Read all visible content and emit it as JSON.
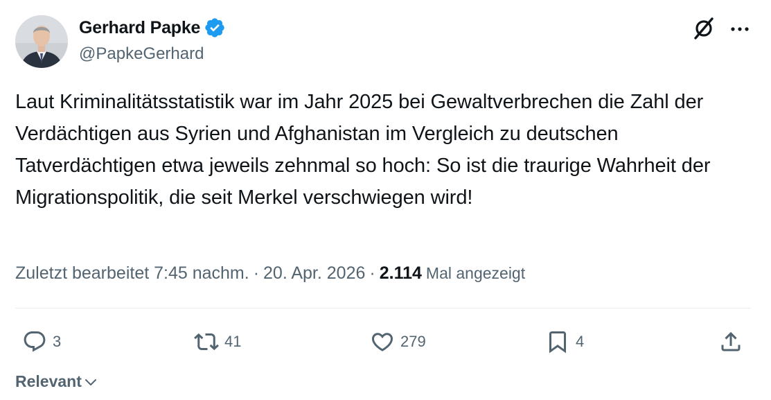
{
  "author": {
    "display_name": "Gerhard Papke",
    "handle": "@PapkeGerhard",
    "verified": true
  },
  "tweet": {
    "text": "Laut Kriminalitätsstatistik war im Jahr 2025 bei Gewaltverbrechen die Zahl der Verdächtigen aus Syrien und Afghanistan im Vergleich zu deutschen Tatverdächtigen etwa jeweils zehnmal so hoch: So ist die traurige Wahrheit der Migrationspolitik, die seit Merkel verschwiegen wird!"
  },
  "meta": {
    "edited_time": "Zuletzt bearbeitet 7:45 nachm.",
    "separator": "·",
    "date": "20. Apr. 2026",
    "views_count": "2.114",
    "views_label": "Mal angezeigt"
  },
  "actions": {
    "replies": "3",
    "reposts": "41",
    "likes": "279",
    "bookmarks": "4"
  },
  "sort": {
    "label": "Relevant"
  },
  "colors": {
    "text_primary": "#0f1419",
    "text_secondary": "#536471",
    "verified_blue": "#1d9bf0",
    "divider": "#e6ecf0"
  },
  "icons": [
    "grok-icon",
    "more-icon",
    "verified-badge-icon",
    "reply-icon",
    "retweet-icon",
    "like-icon",
    "bookmark-icon",
    "share-icon",
    "chevron-down-icon"
  ]
}
